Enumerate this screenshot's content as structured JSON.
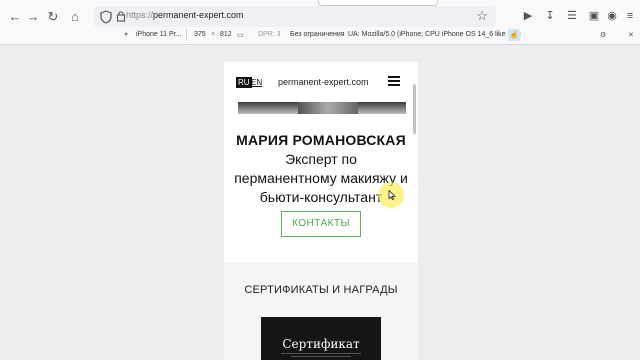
{
  "browser": {
    "url_scheme": "https://",
    "url_host": "permanent-expert.com",
    "icons": [
      "back-icon",
      "forward-icon",
      "reload-icon",
      "home-icon",
      "shield-icon",
      "lock-icon",
      "bookmark-star-icon",
      "extension-icon",
      "download-icon",
      "library-icon",
      "sidebar-icon",
      "profile-icon",
      "menu-icon"
    ]
  },
  "rdm": {
    "device": "iPhone 11 Pr...",
    "width": "375",
    "times": "×",
    "height": "812",
    "dpr": "DPR: 3",
    "throttle": "Без ограничения",
    "ua": "UA: Mozilla/5.0 (iPhone; CPU iPhone OS 14_6 like Mac"
  },
  "site": {
    "lang_ru": "RU",
    "lang_en": "EN",
    "domain": "permanent-expert.com",
    "name": "МАРИЯ РОМАНОВСКАЯ",
    "subtitle": "Эксперт по перманентному макияжу и бьюти-консультант",
    "contact_button": "КОНТАКТЫ",
    "cert_heading": "СЕРТИФИКАТЫ И НАГРАДЫ",
    "cert_card_title": "Сертификат"
  },
  "colors": {
    "accent_green": "#5cb85c",
    "cursor_highlight": "#ffeb50"
  }
}
